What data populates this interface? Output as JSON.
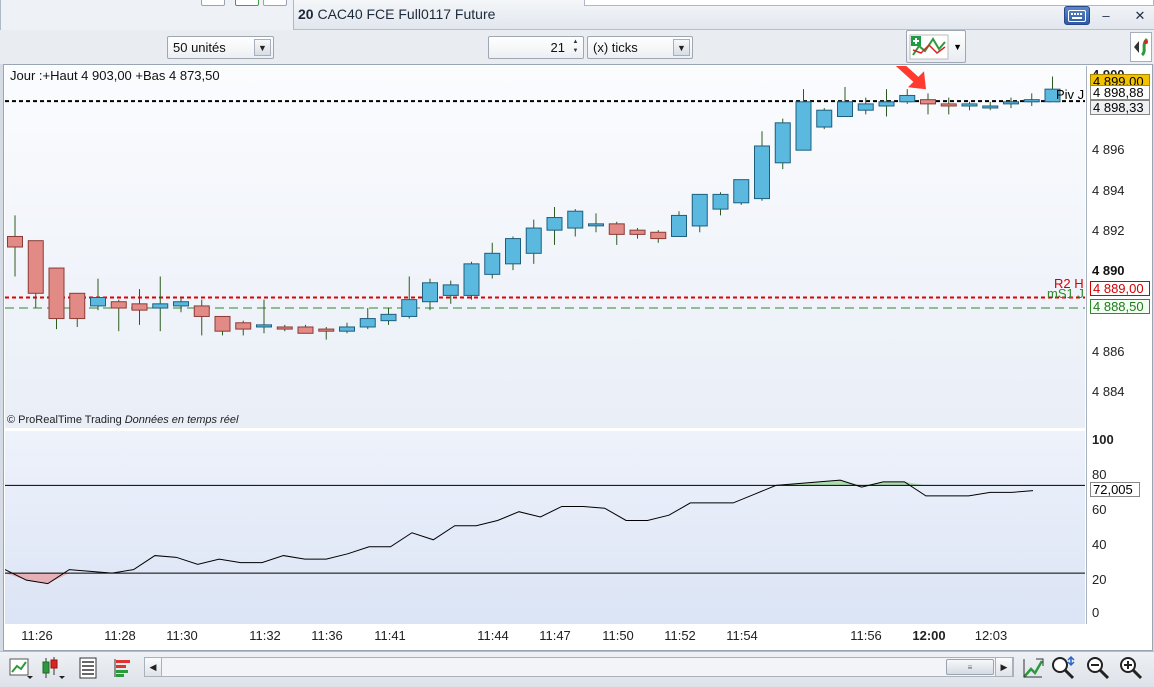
{
  "window": {
    "title_prefix": "20",
    "title": "CAC40 FCE Full0117 Future",
    "keyboard_icon": "keyboard-icon",
    "minimize_symbol": "–",
    "close_symbol": "✕"
  },
  "toolbar": {
    "units_value": "50 unités",
    "ticks_value": "21",
    "ticks_unit": "(x) ticks",
    "indicator_icon": "add-indicator-icon"
  },
  "chart_info": {
    "header": "Jour :+Haut 4 903,00 +Bas 4 873,50",
    "copyright": "© ProRealTime Trading",
    "realtime": "Données en temps réel"
  },
  "price_axis": {
    "labels": [
      "4 896",
      "4 894",
      "4 892",
      "4 890",
      "4 886",
      "4 884"
    ],
    "bold_label": "4 890",
    "top_partial": "4 900",
    "boxes": {
      "high": "4 899,00",
      "pivot": "4 898,88",
      "last": "4 898,33",
      "r2": "4 889,00",
      "mr1": "4 888,50"
    }
  },
  "levels": {
    "pivot_label": "Piv J",
    "r2_label": "R2 H",
    "mr1_label": "mS1 J",
    "colors": {
      "pivot": "#000000",
      "r2": "#e00000",
      "mr1": "#2e8b2e"
    }
  },
  "indicator_axis": {
    "labels": [
      "100",
      "80",
      "60",
      "40",
      "20",
      "0"
    ],
    "value_box": "72,005"
  },
  "time_axis": {
    "labels": [
      "11:26",
      "11:28",
      "11:30",
      "11:32",
      "11:36",
      "11:41",
      "11:44",
      "11:47",
      "11:50",
      "11:52",
      "11:54",
      "11:56",
      "12:00",
      "12:03"
    ],
    "bold_label": "12:00"
  },
  "chart_data": {
    "type": "candlestick",
    "ylim": [
      4882.8,
      4900.0
    ],
    "up_color": "#5bb8de",
    "down_color": "#e28a85",
    "candles": [
      {
        "o": 4891.9,
        "c": 4891.4,
        "h": 4892.9,
        "l": 4890.0
      },
      {
        "o": 4891.7,
        "c": 4889.2,
        "h": 4891.7,
        "l": 4888.5
      },
      {
        "o": 4890.4,
        "c": 4888.0,
        "h": 4890.4,
        "l": 4887.5
      },
      {
        "o": 4889.2,
        "c": 4888.0,
        "h": 4889.2,
        "l": 4887.6
      },
      {
        "o": 4888.6,
        "c": 4889.0,
        "h": 4889.9,
        "l": 4888.4
      },
      {
        "o": 4888.8,
        "c": 4888.5,
        "h": 4888.9,
        "l": 4887.4
      },
      {
        "o": 4888.7,
        "c": 4888.4,
        "h": 4889.4,
        "l": 4887.7
      },
      {
        "o": 4888.5,
        "c": 4888.7,
        "h": 4890.0,
        "l": 4887.4
      },
      {
        "o": 4888.6,
        "c": 4888.8,
        "h": 4889.0,
        "l": 4888.3
      },
      {
        "o": 4888.6,
        "c": 4888.1,
        "h": 4888.9,
        "l": 4887.2
      },
      {
        "o": 4888.1,
        "c": 4887.4,
        "h": 4888.1,
        "l": 4887.2
      },
      {
        "o": 4887.8,
        "c": 4887.5,
        "h": 4887.9,
        "l": 4887.2
      },
      {
        "o": 4887.6,
        "c": 4887.7,
        "h": 4888.9,
        "l": 4887.3
      },
      {
        "o": 4887.6,
        "c": 4887.5,
        "h": 4887.7,
        "l": 4887.4
      },
      {
        "o": 4887.6,
        "c": 4887.3,
        "h": 4887.7,
        "l": 4887.3
      },
      {
        "o": 4887.5,
        "c": 4887.4,
        "h": 4887.6,
        "l": 4887.0
      },
      {
        "o": 4887.4,
        "c": 4887.6,
        "h": 4887.8,
        "l": 4887.3
      },
      {
        "o": 4887.6,
        "c": 4888.0,
        "h": 4888.5,
        "l": 4887.5
      },
      {
        "o": 4887.9,
        "c": 4888.2,
        "h": 4888.5,
        "l": 4887.7
      },
      {
        "o": 4888.1,
        "c": 4888.9,
        "h": 4890.0,
        "l": 4888.0
      },
      {
        "o": 4888.8,
        "c": 4889.7,
        "h": 4889.9,
        "l": 4888.4
      },
      {
        "o": 4889.1,
        "c": 4889.6,
        "h": 4889.8,
        "l": 4888.7
      },
      {
        "o": 4889.1,
        "c": 4890.6,
        "h": 4890.7,
        "l": 4888.9
      },
      {
        "o": 4890.1,
        "c": 4891.1,
        "h": 4891.6,
        "l": 4889.9
      },
      {
        "o": 4890.6,
        "c": 4891.8,
        "h": 4891.9,
        "l": 4890.3
      },
      {
        "o": 4891.1,
        "c": 4892.3,
        "h": 4892.7,
        "l": 4890.6
      },
      {
        "o": 4892.2,
        "c": 4892.8,
        "h": 4893.3,
        "l": 4891.5
      },
      {
        "o": 4892.3,
        "c": 4893.1,
        "h": 4893.2,
        "l": 4891.9
      },
      {
        "o": 4892.5,
        "c": 4892.5,
        "h": 4893.0,
        "l": 4892.1
      },
      {
        "o": 4892.5,
        "c": 4892.0,
        "h": 4892.6,
        "l": 4891.5
      },
      {
        "o": 4892.2,
        "c": 4892.0,
        "h": 4892.3,
        "l": 4891.8
      },
      {
        "o": 4892.1,
        "c": 4891.8,
        "h": 4892.2,
        "l": 4891.6
      },
      {
        "o": 4891.9,
        "c": 4892.9,
        "h": 4893.1,
        "l": 4891.9
      },
      {
        "o": 4892.4,
        "c": 4893.9,
        "h": 4893.9,
        "l": 4892.1
      },
      {
        "o": 4893.2,
        "c": 4893.9,
        "h": 4894.0,
        "l": 4892.9
      },
      {
        "o": 4893.5,
        "c": 4894.6,
        "h": 4894.6,
        "l": 4893.4
      },
      {
        "o": 4893.7,
        "c": 4896.2,
        "h": 4896.9,
        "l": 4893.6
      },
      {
        "o": 4895.4,
        "c": 4897.3,
        "h": 4897.5,
        "l": 4895.1
      },
      {
        "o": 4896.0,
        "c": 4898.3,
        "h": 4898.9,
        "l": 4896.0
      },
      {
        "o": 4897.1,
        "c": 4897.9,
        "h": 4898.0,
        "l": 4897.0
      },
      {
        "o": 4897.6,
        "c": 4898.3,
        "h": 4899.0,
        "l": 4897.6
      },
      {
        "o": 4897.9,
        "c": 4898.2,
        "h": 4898.5,
        "l": 4897.7
      },
      {
        "o": 4898.1,
        "c": 4898.3,
        "h": 4898.9,
        "l": 4897.6
      },
      {
        "o": 4898.3,
        "c": 4898.6,
        "h": 4898.9,
        "l": 4898.2
      },
      {
        "o": 4898.4,
        "c": 4898.2,
        "h": 4898.7,
        "l": 4897.7
      },
      {
        "o": 4898.2,
        "c": 4898.1,
        "h": 4898.5,
        "l": 4897.7
      },
      {
        "o": 4898.1,
        "c": 4898.2,
        "h": 4898.3,
        "l": 4897.9
      },
      {
        "o": 4898.1,
        "c": 4898.1,
        "h": 4898.3,
        "l": 4897.9
      },
      {
        "o": 4898.2,
        "c": 4898.3,
        "h": 4898.5,
        "l": 4898.0
      },
      {
        "o": 4898.3,
        "c": 4898.4,
        "h": 4898.7,
        "l": 4898.1
      },
      {
        "o": 4898.3,
        "c": 4898.9,
        "h": 4899.5,
        "l": 4898.3
      }
    ],
    "levels": [
      {
        "name": "Piv J",
        "value": 4898.33,
        "style": "dotted",
        "color": "#000000"
      },
      {
        "name": "R2 H",
        "value": 4889.0,
        "style": "dotted",
        "color": "#e00000"
      },
      {
        "name": "mS1 J",
        "value": 4888.5,
        "style": "dashed",
        "color": "#2e8b2e"
      }
    ],
    "indicator": {
      "ylim": [
        -4,
        106
      ],
      "upper_band": 75,
      "lower_band": 25,
      "values": [
        27,
        21,
        19,
        27,
        26,
        25,
        27,
        35,
        34,
        30,
        33,
        31,
        31,
        35,
        33,
        33,
        36,
        40,
        40,
        48,
        44,
        52,
        52,
        55,
        60,
        57,
        63,
        63,
        62,
        55,
        55,
        58,
        65,
        65,
        65,
        70,
        75,
        76,
        77,
        78,
        74,
        77,
        77,
        69,
        69,
        69,
        71,
        71,
        72
      ]
    }
  }
}
